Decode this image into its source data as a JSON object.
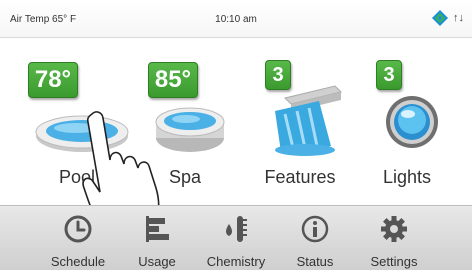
{
  "status_bar": {
    "air_temp": "Air Temp 65° F",
    "time": "10:10 am",
    "connection_arrows": "↑↓"
  },
  "tiles": {
    "pool": {
      "label": "Pool",
      "badge": "78°"
    },
    "spa": {
      "label": "Spa",
      "badge": "85°"
    },
    "features": {
      "label": "Features",
      "badge": "3"
    },
    "lights": {
      "label": "Lights",
      "badge": "3"
    }
  },
  "nav": {
    "schedule": "Schedule",
    "usage": "Usage",
    "chemistry": "Chemistry",
    "status": "Status",
    "settings": "Settings"
  },
  "icons": {
    "logo": "pentair-logo-icon",
    "pool": "pool-icon",
    "spa": "spa-icon",
    "features": "waterfall-icon",
    "lights": "light-bulb-icon",
    "schedule": "clock-icon",
    "usage": "bar-chart-icon",
    "chemistry": "thermometer-drop-icon",
    "status": "info-icon",
    "settings": "gear-icon",
    "hand": "pointing-hand-icon"
  },
  "colors": {
    "badge_green": "#4aa83b",
    "water_blue": "#4ab0e6",
    "nav_icon": "#555555"
  }
}
